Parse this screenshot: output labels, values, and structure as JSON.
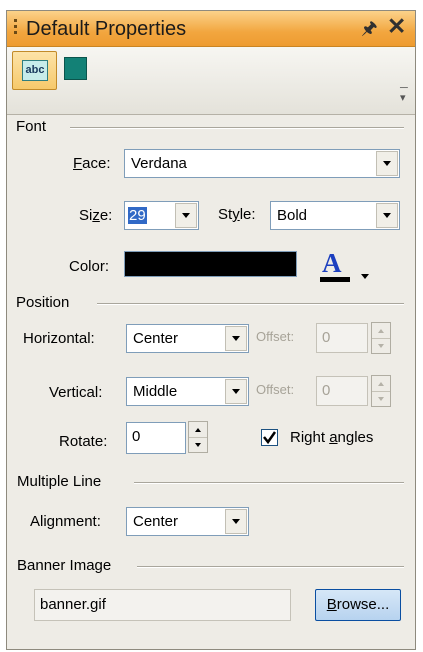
{
  "panel": {
    "title": "Default Properties"
  },
  "toolbar": {
    "text_tool_label": "abc"
  },
  "font": {
    "section_label": "Font",
    "face_label_accel": "F",
    "face_label_rest": "ace:",
    "face_value": "Verdana",
    "size_label_pre": "Si",
    "size_label_accel": "z",
    "size_label_post": "e:",
    "size_value": "29",
    "style_label_pre": "St",
    "style_label_accel": "y",
    "style_label_post": "le:",
    "style_value": "Bold",
    "color_label": "Color:",
    "color_value": "#000000",
    "font_color_glyph": "A"
  },
  "position": {
    "section_label": "Position",
    "horizontal_label": "Horizontal:",
    "horizontal_value": "Center",
    "h_offset_label": "Offset:",
    "h_offset_value": "0",
    "vertical_label": "Vertical:",
    "vertical_value": "Middle",
    "v_offset_label": "Offset:",
    "v_offset_value": "0",
    "rotate_label": "Rotate:",
    "rotate_value": "0",
    "right_angles_pre": "Right ",
    "right_angles_accel": "a",
    "right_angles_post": "ngles",
    "right_angles_checked": true
  },
  "multiple_line": {
    "section_label": "Multiple Line",
    "alignment_label": "Alignment:",
    "alignment_value": "Center"
  },
  "banner": {
    "section_label": "Banner Image",
    "file_value": "banner.gif",
    "browse_accel": "B",
    "browse_rest": "rowse..."
  },
  "colors": {
    "title_gradient_top": "#fbd28a",
    "title_gradient_bottom": "#ee9b30",
    "panel_bg": "#eeece6",
    "selection": "#3169c6",
    "font_color_underline": "#000000",
    "font_color_letter": "#1c3fbf"
  }
}
